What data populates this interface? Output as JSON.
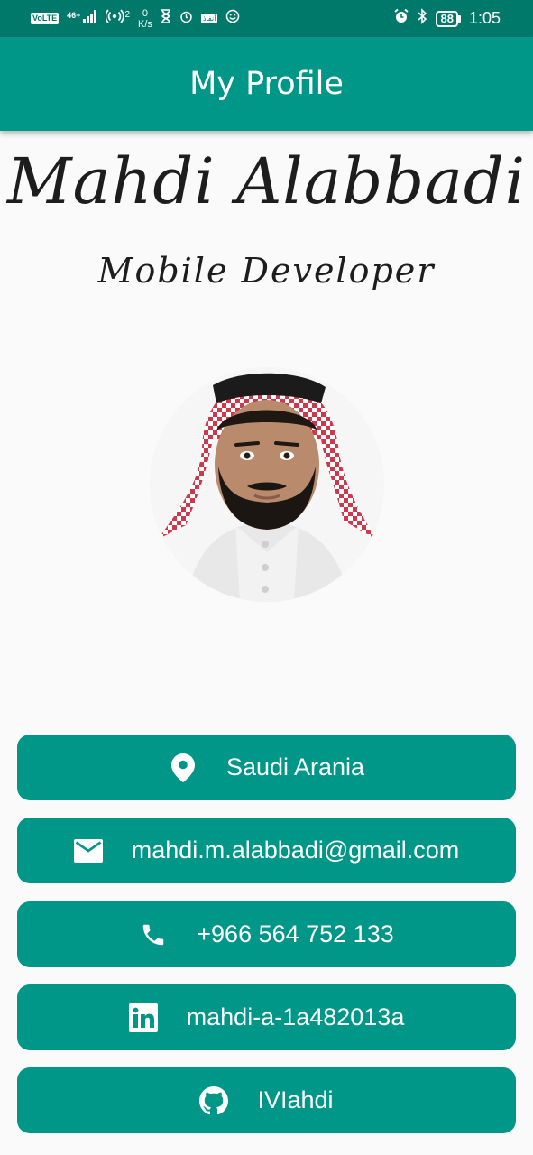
{
  "status_bar": {
    "volte": "VoLTE",
    "network": "46+",
    "hotspot_count": "2",
    "speed_value": "0",
    "speed_unit": "K/s",
    "app_badge": "أنفاذ",
    "battery": "88",
    "time": "1:05"
  },
  "app_bar": {
    "title": "My Profile"
  },
  "profile": {
    "name": "Mahdi Alabbadi",
    "role": "Mobile Developer"
  },
  "contacts": [
    {
      "icon": "location-pin-icon",
      "text": "Saudi Arania"
    },
    {
      "icon": "email-icon",
      "text": "mahdi.m.alabbadi@gmail.com"
    },
    {
      "icon": "phone-icon",
      "text": "+966 564 752 133"
    },
    {
      "icon": "linkedin-icon",
      "text": "mahdi-a-1a482013a"
    },
    {
      "icon": "github-icon",
      "text": "IVIahdi"
    }
  ],
  "colors": {
    "status_bar": "#00796b",
    "primary": "#009688",
    "background": "#fafafa",
    "text_on_primary": "#ffffff"
  }
}
